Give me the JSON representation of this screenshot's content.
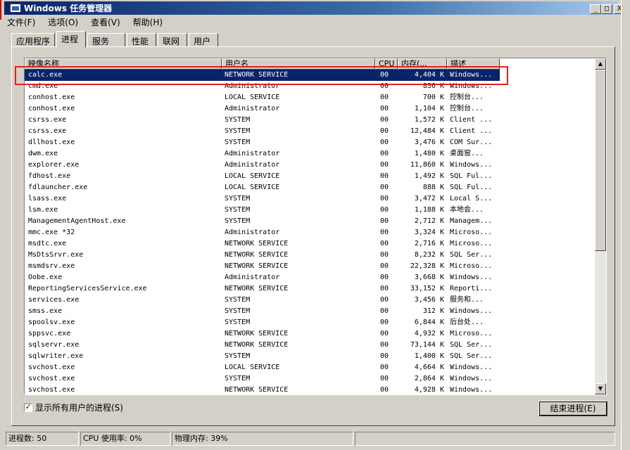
{
  "window": {
    "title": "Windows 任务管理器",
    "controls": [
      "_",
      "□",
      "X"
    ]
  },
  "menu": [
    {
      "label": "文件(F)"
    },
    {
      "label": "选项(O)"
    },
    {
      "label": "查看(V)"
    },
    {
      "label": "帮助(H)"
    }
  ],
  "tabs": [
    {
      "label": "应用程序",
      "active": false
    },
    {
      "label": "进程",
      "active": true
    },
    {
      "label": "服务",
      "active": false
    },
    {
      "label": "性能",
      "active": false
    },
    {
      "label": "联网",
      "active": false
    },
    {
      "label": "用户",
      "active": false
    }
  ],
  "table": {
    "columns": [
      "映像名称",
      "用户名",
      "CPU",
      "内存(...",
      "描述"
    ],
    "rows": [
      {
        "name": "calc.exe",
        "user": "NETWORK SERVICE",
        "cpu": "00",
        "mem": "4,404 K",
        "desc": "Windows...",
        "selected": true
      },
      {
        "name": "cmd.exe",
        "user": "Administrator",
        "cpu": "00",
        "mem": "836 K",
        "desc": "Windows..."
      },
      {
        "name": "conhost.exe",
        "user": "LOCAL SERVICE",
        "cpu": "00",
        "mem": "700 K",
        "desc": "控制台..."
      },
      {
        "name": "conhost.exe",
        "user": "Administrator",
        "cpu": "00",
        "mem": "1,104 K",
        "desc": "控制台..."
      },
      {
        "name": "csrss.exe",
        "user": "SYSTEM",
        "cpu": "00",
        "mem": "1,572 K",
        "desc": "Client ..."
      },
      {
        "name": "csrss.exe",
        "user": "SYSTEM",
        "cpu": "00",
        "mem": "12,484 K",
        "desc": "Client ..."
      },
      {
        "name": "dllhost.exe",
        "user": "SYSTEM",
        "cpu": "00",
        "mem": "3,476 K",
        "desc": "COM Sur..."
      },
      {
        "name": "dwm.exe",
        "user": "Administrator",
        "cpu": "00",
        "mem": "1,480 K",
        "desc": "桌面窗..."
      },
      {
        "name": "explorer.exe",
        "user": "Administrator",
        "cpu": "00",
        "mem": "11,860 K",
        "desc": "Windows..."
      },
      {
        "name": "fdhost.exe",
        "user": "LOCAL SERVICE",
        "cpu": "00",
        "mem": "1,492 K",
        "desc": "SQL Ful..."
      },
      {
        "name": "fdlauncher.exe",
        "user": "LOCAL SERVICE",
        "cpu": "00",
        "mem": "888 K",
        "desc": "SQL Ful..."
      },
      {
        "name": "lsass.exe",
        "user": "SYSTEM",
        "cpu": "00",
        "mem": "3,472 K",
        "desc": "Local S..."
      },
      {
        "name": "lsm.exe",
        "user": "SYSTEM",
        "cpu": "00",
        "mem": "1,188 K",
        "desc": "本地会..."
      },
      {
        "name": "ManagementAgentHost.exe",
        "user": "SYSTEM",
        "cpu": "00",
        "mem": "2,712 K",
        "desc": "Managem..."
      },
      {
        "name": "mmc.exe *32",
        "user": "Administrator",
        "cpu": "00",
        "mem": "3,324 K",
        "desc": "Microso..."
      },
      {
        "name": "msdtc.exe",
        "user": "NETWORK SERVICE",
        "cpu": "00",
        "mem": "2,716 K",
        "desc": "Microso..."
      },
      {
        "name": "MsDtsSrvr.exe",
        "user": "NETWORK SERVICE",
        "cpu": "00",
        "mem": "8,232 K",
        "desc": "SQL Ser..."
      },
      {
        "name": "msmdsrv.exe",
        "user": "NETWORK SERVICE",
        "cpu": "00",
        "mem": "22,328 K",
        "desc": "Microso..."
      },
      {
        "name": "Oobe.exe",
        "user": "Administrator",
        "cpu": "00",
        "mem": "3,668 K",
        "desc": "Windows..."
      },
      {
        "name": "ReportingServicesService.exe",
        "user": "NETWORK SERVICE",
        "cpu": "00",
        "mem": "33,152 K",
        "desc": "Reporti..."
      },
      {
        "name": "services.exe",
        "user": "SYSTEM",
        "cpu": "00",
        "mem": "3,456 K",
        "desc": "服务和..."
      },
      {
        "name": "smss.exe",
        "user": "SYSTEM",
        "cpu": "00",
        "mem": "312 K",
        "desc": "Windows..."
      },
      {
        "name": "spoolsv.exe",
        "user": "SYSTEM",
        "cpu": "00",
        "mem": "6,844 K",
        "desc": "后台处..."
      },
      {
        "name": "sppsvc.exe",
        "user": "NETWORK SERVICE",
        "cpu": "00",
        "mem": "4,932 K",
        "desc": "Microso..."
      },
      {
        "name": "sqlservr.exe",
        "user": "NETWORK SERVICE",
        "cpu": "00",
        "mem": "73,144 K",
        "desc": "SQL Ser..."
      },
      {
        "name": "sqlwriter.exe",
        "user": "SYSTEM",
        "cpu": "00",
        "mem": "1,400 K",
        "desc": "SQL Ser..."
      },
      {
        "name": "svchost.exe",
        "user": "LOCAL SERVICE",
        "cpu": "00",
        "mem": "4,664 K",
        "desc": "Windows..."
      },
      {
        "name": "svchost.exe",
        "user": "SYSTEM",
        "cpu": "00",
        "mem": "2,864 K",
        "desc": "Windows..."
      },
      {
        "name": "svchost.exe",
        "user": "NETWORK SERVICE",
        "cpu": "00",
        "mem": "4,928 K",
        "desc": "Windows..."
      }
    ]
  },
  "show_all_users": {
    "label": "显示所有用户的进程(S)",
    "checked": true
  },
  "end_process_button": "结束进程(E)",
  "status": {
    "processes": "进程数: 50",
    "cpu": "CPU 使用率: 0%",
    "memory": "物理内存: 39%"
  },
  "colors": {
    "selection": "#0a246a",
    "highlight_box": "#e02020",
    "window_bg": "#d4d0c8"
  }
}
